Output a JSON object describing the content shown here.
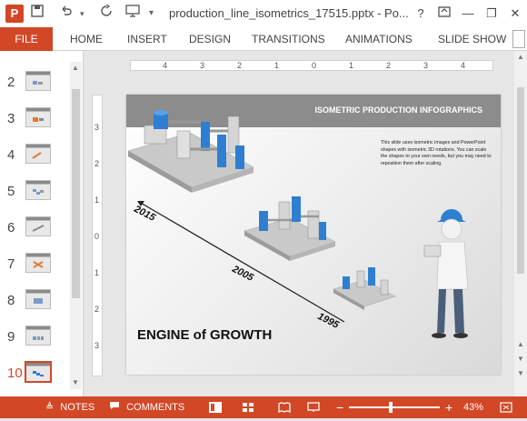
{
  "titlebar": {
    "app_icon": "P",
    "doc_title": "production_line_isometrics_17515.pptx - Po...",
    "help": "?",
    "minimize": "—",
    "restore": "❐",
    "close": "✕"
  },
  "ribbon": {
    "file": "FILE",
    "tabs": [
      "HOME",
      "INSERT",
      "DESIGN",
      "TRANSITIONS",
      "ANIMATIONS",
      "SLIDE SHOW"
    ]
  },
  "thumbnails": {
    "numbers": [
      "2",
      "3",
      "4",
      "5",
      "6",
      "7",
      "8",
      "9",
      "10"
    ],
    "active": "10"
  },
  "ruler": {
    "top_labels": [
      "4",
      "3",
      "2",
      "1",
      "0",
      "1",
      "2",
      "3",
      "4"
    ],
    "left_labels": [
      "3",
      "2",
      "1",
      "0",
      "1",
      "2",
      "3"
    ]
  },
  "slide": {
    "header_title": "ISOMETRIC PRODUCTION INFOGRAPHICS",
    "body_text": "This slide uses isometric images and PowerPoint shapes with isometric 3D rotations. You can scale the shapes to your own needs, but you may need to reposition them after scaling.",
    "years": [
      "2015",
      "2005",
      "1995"
    ],
    "engine_text": "ENGINE of GROWTH"
  },
  "statusbar": {
    "notes": "NOTES",
    "comments": "COMMENTS",
    "zoom": "43%"
  },
  "colors": {
    "accent": "#d24726",
    "header_gray": "#8c8c8c",
    "machine_blue": "#2e7fd0"
  }
}
